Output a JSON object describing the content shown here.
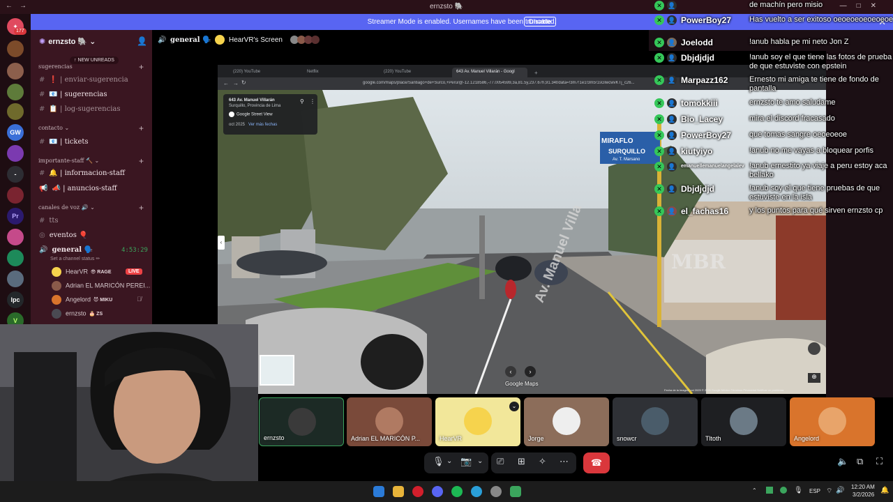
{
  "window": {
    "title": "ernzsto 🐘",
    "nav_back": "←",
    "nav_fwd": "→",
    "minimize": "—",
    "maximize": "□",
    "close": "✕"
  },
  "streamer_bar": {
    "message": "Streamer Mode is enabled. Usernames have been truncated.",
    "disable_label": "Disable",
    "close": "✕"
  },
  "rail": {
    "badge": "177",
    "items": [
      "ds",
      "sv1",
      "sv2",
      "sv3",
      "GW",
      "sv5",
      "-",
      "sv7",
      "Pr",
      "sv9",
      "sv10",
      "sv11",
      "lpc",
      "V"
    ]
  },
  "sidebar": {
    "server_name": "ernzsto 🐘",
    "chevron": "⌄",
    "new_unreads": "↑ NEW UNREADS",
    "categories": [
      {
        "label": "sugerencias"
      },
      {
        "label": "contacto ⌄"
      },
      {
        "label": "importante-staff 🔨 ⌄"
      },
      {
        "label": "canales de voz 🔊 ⌄"
      }
    ],
    "channels": {
      "enviar": "❗ | enviar-sugerencia",
      "sugerencias": "📧 | sugerencias",
      "log": "📋 | log-sugerencias",
      "tickets": "📧 | tickets",
      "info_staff": "🔔 | informacion-staff",
      "anuncios_staff": "📣 | anuncios-staff",
      "tts": "tts",
      "eventos": "eventos 🎈",
      "general": "general 🗣️",
      "general_timer": "4:53:29",
      "channel_status": "Set a channel status ✏"
    },
    "voice_users": [
      {
        "name": "HearVR",
        "tag": "😎 RAGE",
        "live": "LIVE"
      },
      {
        "name": "Adrian EL MARICÓN PEREI...",
        "tag": ""
      },
      {
        "name": "Angelord",
        "tag": "😈 MIKU"
      },
      {
        "name": "ernzsto",
        "tag": "🎂 ZS"
      }
    ]
  },
  "channel_header": {
    "channel": "general 🗣️",
    "screen_title": "HearVR's Screen"
  },
  "browser": {
    "tabs": [
      "(220) YouTube",
      "Netflix",
      "(220) YouTube",
      "643 Av. Manuel Villarán - Googl"
    ],
    "new_tab": "+",
    "url": "google.com/maps/place/Santiago+de+Surco,+Perú/@-12.1218586,-77.0054599,3a,81.5y,237.67h,91.34t/data=!3m7!1e1!3m5!1sGlwcwvKTj_c26...",
    "info_title": "643 Av. Manuel Villarán",
    "info_sub": "Surquillo, Provincia de Lima",
    "info_source": "Google Street View",
    "info_date": "oct 2025",
    "info_more": "Ver más fechas",
    "sign_1": "MIRAFLO",
    "sign_2": "SURQUILLO",
    "sign_3": "Av. T. Marsano",
    "road_text": "Av. Manuel Villa",
    "graffiti": "MBR",
    "maps_label": "Google Maps",
    "footer": "Fecha de la imagen: oct 2025  © 2026 Google  México  Términos  Privacidad  Notificar un problema"
  },
  "chat": [
    {
      "user": "",
      "text": "de machín pero misio"
    },
    {
      "user": "PowerBoy27",
      "text": "Has vuelto a ser exitoso oeoeoeoeoeoeoe"
    },
    {
      "user": "Joelodd",
      "text": "!anub habla pe mi neto Jon Z"
    },
    {
      "user": "Dbjdjdjd",
      "text": "!anub soy el que tiene las fotos de prueba de que estuviste con epstein"
    },
    {
      "user": "Marpazz162",
      "text": "Ernesto mi amiga te tiene de fondo de pantalla"
    },
    {
      "user": "tomokkiii",
      "text": "ernzsto te amo saludame"
    },
    {
      "user": "Bio_Lacey",
      "text": "mira el discord fracasado"
    },
    {
      "user": "PowerBoy27",
      "text": "que tomas sangre oeoeoeoe"
    },
    {
      "user": "kiutyiyo",
      "text": "!anub no me vayas a bloquear porfis"
    },
    {
      "user": "emanuellemanuelangelalev",
      "text": "!anub ernestito ya viaje a peru estoy aca bellako"
    },
    {
      "user": "Dbjdjdjd",
      "text": "!anub soy el que tiene pruebas de que estuviste en la isla"
    },
    {
      "user": "el_fachas16",
      "text": "y los puntos para qué sirven ernzsto cp"
    }
  ],
  "participants": [
    {
      "name": "ernzsto",
      "color": "#1c2a25"
    },
    {
      "name": "Adrian EL MARICÓN P...",
      "color": "#7a4a3a"
    },
    {
      "name": "HearVR",
      "color": "#f2e79a"
    },
    {
      "name": "Jorge",
      "color": "#8c6d5a"
    },
    {
      "name": "snowcr",
      "color": "#2f3136"
    },
    {
      "name": "Tltoth",
      "color": "#1e1f22"
    },
    {
      "name": "Angelord",
      "color": "#d9742c"
    }
  ],
  "taskbar": {
    "lang": "ESP",
    "time": "12:20 AM",
    "date": "3/2/2026",
    "up_arrow": "⌃"
  }
}
